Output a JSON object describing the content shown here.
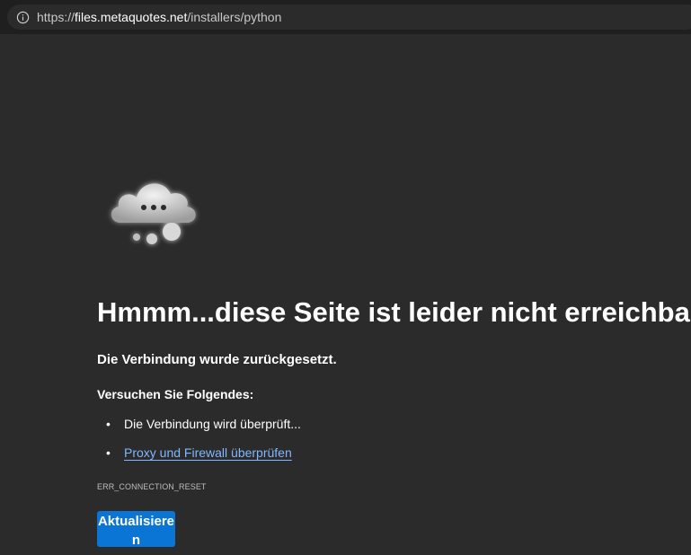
{
  "browser": {
    "url_prefix": "https://",
    "url_host": "files.metaquotes.net",
    "url_path": "/installers/python",
    "info_icon": "info-circle-icon"
  },
  "error_page": {
    "illustration_icon": "cloud-thinking-icon",
    "title": "Hmmm...diese Seite ist leider nicht erreichbar",
    "subtitle": "Die Verbindung wurde zurückgesetzt.",
    "try_heading": "Versuchen Sie Folgendes:",
    "suggestions": [
      {
        "text": "Die Verbindung wird überprüft...",
        "is_link": false
      },
      {
        "text": "Proxy und Firewall überprüfen",
        "is_link": true
      }
    ],
    "error_code": "ERR_CONNECTION_RESET",
    "refresh_button": "Aktualisieren"
  },
  "colors": {
    "background": "#2b2b2b",
    "link": "#7fb8ff",
    "button": "#0b75d6"
  }
}
